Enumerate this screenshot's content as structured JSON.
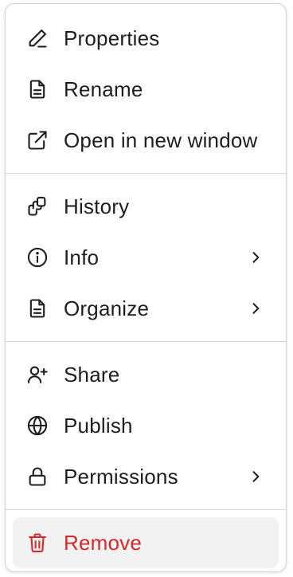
{
  "menu": {
    "group1": [
      {
        "label": "Properties",
        "icon": "pencil-icon"
      },
      {
        "label": "Rename",
        "icon": "document-icon"
      },
      {
        "label": "Open in new window",
        "icon": "external-link-icon"
      }
    ],
    "group2": [
      {
        "label": "History",
        "icon": "copy-stack-icon"
      },
      {
        "label": "Info",
        "icon": "info-circle-icon",
        "submenu": true
      },
      {
        "label": "Organize",
        "icon": "document-icon",
        "submenu": true
      }
    ],
    "group3": [
      {
        "label": "Share",
        "icon": "user-plus-icon"
      },
      {
        "label": "Publish",
        "icon": "globe-icon"
      },
      {
        "label": "Permissions",
        "icon": "lock-icon",
        "submenu": true
      }
    ],
    "danger": {
      "label": "Remove",
      "icon": "trash-icon",
      "color": "#d9262a",
      "highlight": "#f2f2f2"
    }
  }
}
